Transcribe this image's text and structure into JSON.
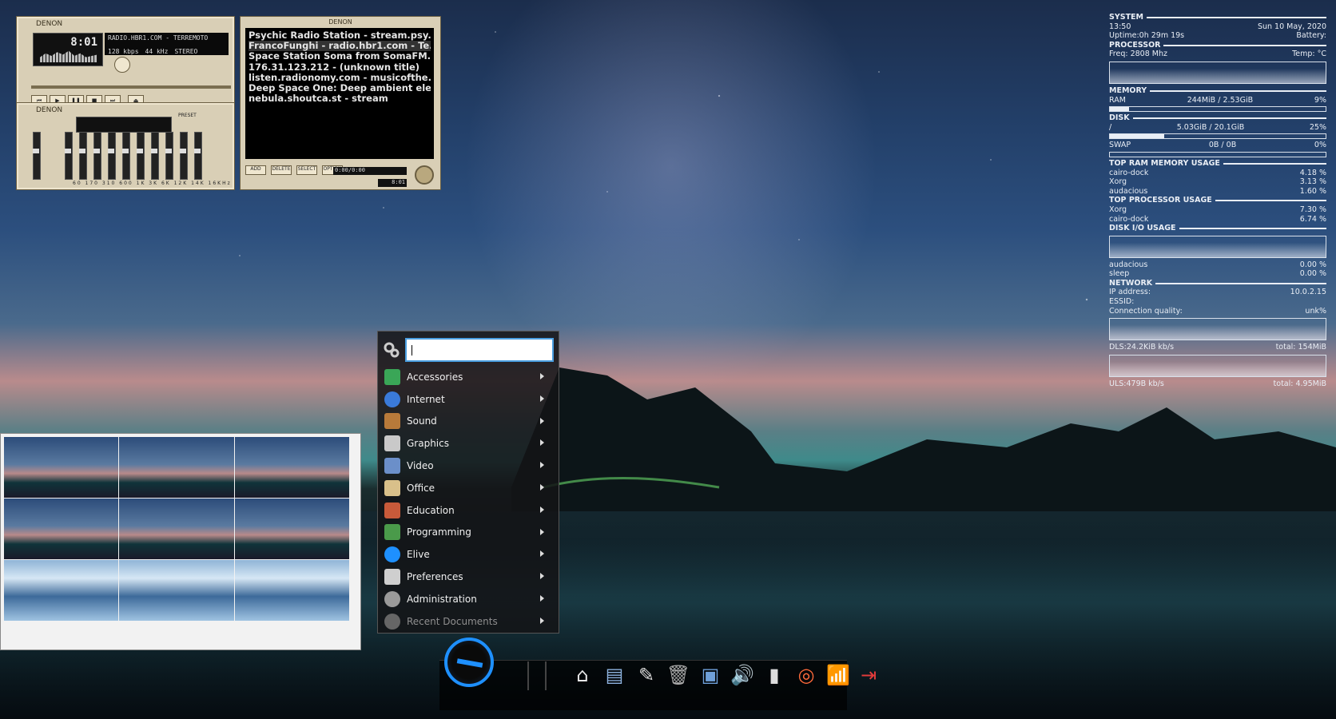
{
  "player": {
    "brand": "DENON",
    "time": "8:01",
    "station": "RADIO.HBR1.COM - TERREMOTO",
    "bitrate": "128 kbps",
    "samplerate": "44 kHz",
    "mode": "STEREO"
  },
  "equalizer": {
    "brand": "DENON",
    "preset_label": "PRESET",
    "bands": "60 170 310 600 1K 3K 6K 12K 14K 16KHz"
  },
  "playlist": {
    "brand": "DENON",
    "items": [
      "Psychic Radio Station - stream.psy...",
      "FrancoFunghi - radio.hbr1.com - Te...",
      "Space Station Soma from SomaFM....",
      "176.31.123.212 - (unknown title)",
      "listen.radionomy.com - musicofthe...",
      "Deep Space One: Deep ambient ele...",
      "nebula.shoutca.st - stream"
    ],
    "buttons": [
      "ADD",
      "DELETE",
      "SELECT",
      "OPTION"
    ],
    "time_display": "0:00/0:00",
    "current": "8:01"
  },
  "conky": {
    "system": "SYSTEM",
    "time": "13:50",
    "date": "Sun 10 May, 2020",
    "uptime": "Uptime:0h 29m 19s",
    "battery": "Battery:",
    "processor": "PROCESSOR",
    "freq": "Freq: 2808 Mhz",
    "temp": "Temp: °C",
    "memory": "MEMORY",
    "ram_label": "RAM",
    "ram": "244MiB / 2.53GiB",
    "ram_pct": "9%",
    "ram_fill": 0.09,
    "disk": "DISK",
    "disk_label": "/",
    "disk_used": "5.03GiB / 20.1GiB",
    "disk_pct": "25%",
    "disk_fill": 0.25,
    "swap_label": "SWAP",
    "swap": "0B  / 0B",
    "swap_pct": "0%",
    "top_ram": "TOP RAM MEMORY USAGE",
    "ram_procs": [
      [
        "cairo-dock",
        "4.18 %"
      ],
      [
        "Xorg",
        "3.13 %"
      ],
      [
        "audacious",
        "1.60 %"
      ]
    ],
    "top_cpu": "TOP PROCESSOR USAGE",
    "cpu_procs": [
      [
        "Xorg",
        "7.30 %"
      ],
      [
        "cairo-dock",
        "6.74 %"
      ]
    ],
    "disk_io": "DISK I/O USAGE",
    "io_procs": [
      [
        "audacious",
        "0.00 %"
      ],
      [
        "sleep",
        "0.00 %"
      ]
    ],
    "network": "NETWORK",
    "ip_label": "IP address:",
    "ip": "10.0.2.15",
    "essid": "ESSID:",
    "quality_label": "Connection quality:",
    "quality": "unk%",
    "dls": "DLS:24.2KiB kb/s",
    "dls_total": "total: 154MiB",
    "uls": "ULS:479B  kb/s",
    "uls_total": "total: 4.95MiB"
  },
  "menu": {
    "search_placeholder": "",
    "items": [
      {
        "label": "Accessories",
        "icon": "accessories-icon",
        "color": "#3aa657"
      },
      {
        "label": "Internet",
        "icon": "globe-icon",
        "color": "#3a7ad9"
      },
      {
        "label": "Sound",
        "icon": "guitar-icon",
        "color": "#b87a3a"
      },
      {
        "label": "Graphics",
        "icon": "brush-icon",
        "color": "#c9c9c9"
      },
      {
        "label": "Video",
        "icon": "video-icon",
        "color": "#6b8fc9"
      },
      {
        "label": "Office",
        "icon": "office-icon",
        "color": "#d9c08a"
      },
      {
        "label": "Education",
        "icon": "education-icon",
        "color": "#c85a3a"
      },
      {
        "label": "Programming",
        "icon": "programming-icon",
        "color": "#4a9a4a"
      },
      {
        "label": "Elive",
        "icon": "elive-icon",
        "color": "#1e90ff"
      },
      {
        "label": "Preferences",
        "icon": "preferences-icon",
        "color": "#cfcfcf"
      },
      {
        "label": "Administration",
        "icon": "administration-icon",
        "color": "#9a9a9a"
      },
      {
        "label": "Recent Documents",
        "icon": "recent-icon",
        "color": "#666666"
      }
    ]
  },
  "dock": {
    "icons": [
      "home-icon",
      "documents-icon",
      "text-editor-icon",
      "trash-icon",
      "image-viewer-icon",
      "volume-icon",
      "battery-icon",
      "help-icon",
      "wifi-icon",
      "logout-icon"
    ]
  }
}
